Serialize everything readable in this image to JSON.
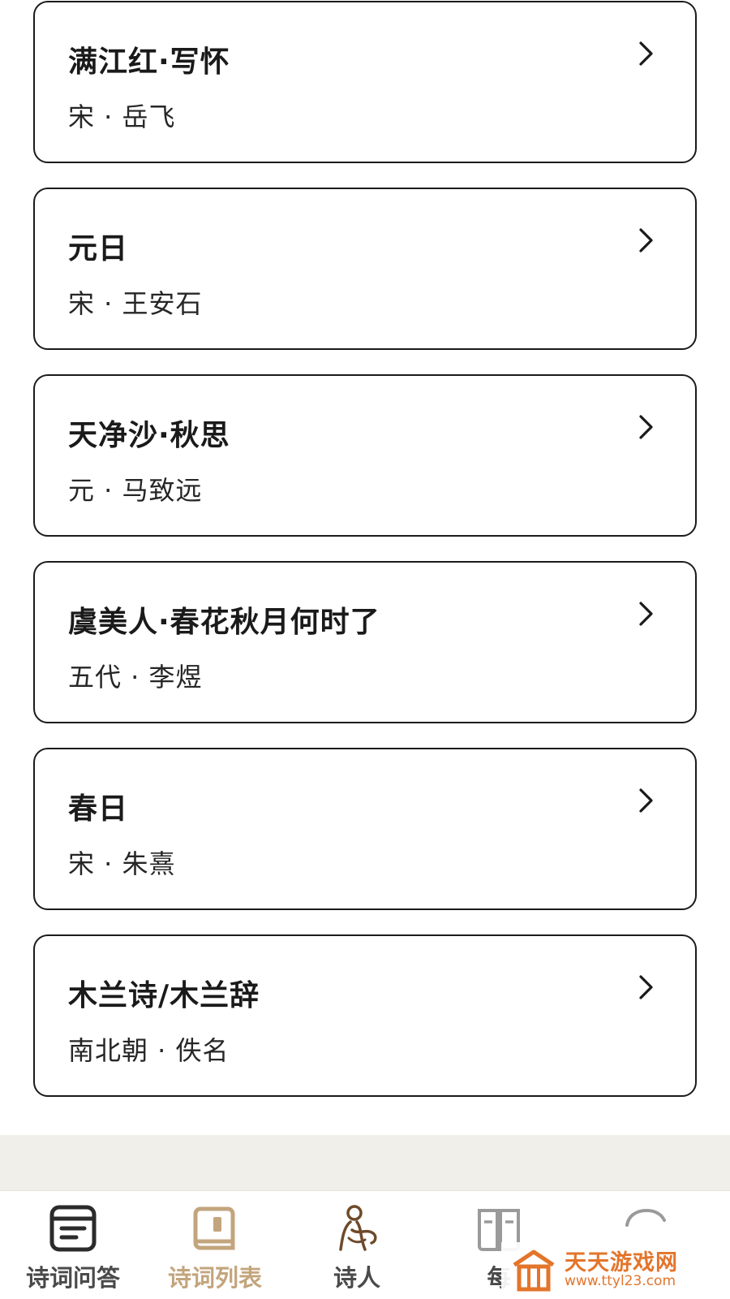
{
  "poems": [
    {
      "title": "满江红·写怀",
      "meta": "宋 · 岳飞"
    },
    {
      "title": "元日",
      "meta": "宋 · 王安石"
    },
    {
      "title": "天净沙·秋思",
      "meta": "元 · 马致远"
    },
    {
      "title": "虞美人·春花秋月何时了",
      "meta": "五代 · 李煜"
    },
    {
      "title": "春日",
      "meta": "宋 · 朱熹"
    },
    {
      "title": "木兰诗/木兰辞",
      "meta": "南北朝 · 佚名"
    }
  ],
  "tabs": [
    {
      "label": "诗词问答",
      "icon": "quiz-icon",
      "active": false
    },
    {
      "label": "诗词列表",
      "icon": "book-icon",
      "active": true
    },
    {
      "label": "诗人",
      "icon": "poet-icon",
      "active": false
    },
    {
      "label": "每",
      "icon": "open-book-icon",
      "active": false
    }
  ],
  "watermark": {
    "name": "天天游戏网",
    "url": "www.ttyl23.com"
  },
  "colors": {
    "accent": "#c3a57d",
    "text": "#1a1a1a",
    "border": "#1b1b1b",
    "strip": "#f1efea",
    "watermark": "#e3752b"
  }
}
